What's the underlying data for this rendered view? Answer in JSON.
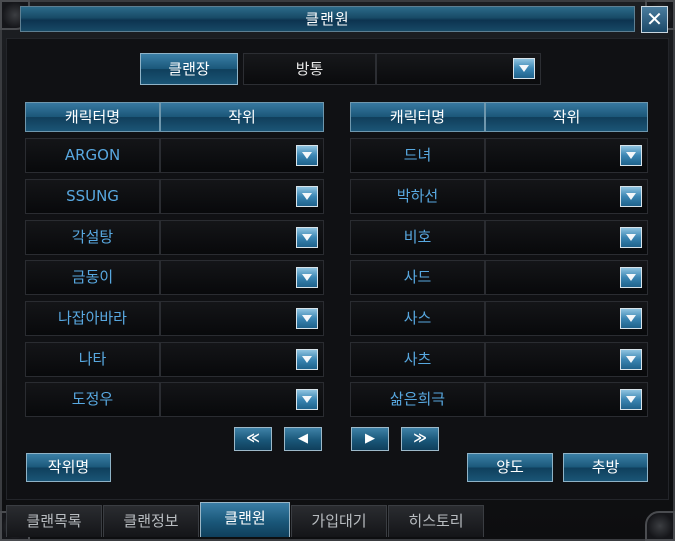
{
  "window": {
    "title": "클랜원",
    "close_label": "✕"
  },
  "top_row": {
    "leader_label": "클랜장",
    "leader_name": "방통",
    "rank_value": ""
  },
  "columns": {
    "name_header": "캐릭터명",
    "rank_header": "작위"
  },
  "left_members": [
    {
      "name": "ARGON",
      "rank": ""
    },
    {
      "name": "SSUNG",
      "rank": ""
    },
    {
      "name": "각설탕",
      "rank": ""
    },
    {
      "name": "금동이",
      "rank": ""
    },
    {
      "name": "나잡아바라",
      "rank": ""
    },
    {
      "name": "나타",
      "rank": ""
    },
    {
      "name": "도정우",
      "rank": ""
    }
  ],
  "right_members": [
    {
      "name": "드녀",
      "rank": ""
    },
    {
      "name": "박하선",
      "rank": ""
    },
    {
      "name": "비호",
      "rank": ""
    },
    {
      "name": "사드",
      "rank": ""
    },
    {
      "name": "사스",
      "rank": ""
    },
    {
      "name": "사츠",
      "rank": ""
    },
    {
      "name": "삶은희극",
      "rank": ""
    }
  ],
  "pager": {
    "first": "≪",
    "prev": "◀",
    "next": "▶",
    "last": "≫"
  },
  "actions": {
    "rank_name_button": "작위명",
    "transfer_button": "양도",
    "kick_button": "추방"
  },
  "tabs": [
    {
      "label": "클랜목록",
      "active": false
    },
    {
      "label": "클랜정보",
      "active": false
    },
    {
      "label": "클랜원",
      "active": true
    },
    {
      "label": "가입대기",
      "active": false
    },
    {
      "label": "히스토리",
      "active": false
    }
  ],
  "colors": {
    "accent": "#1a5779",
    "member_name": "#58a8e0"
  }
}
